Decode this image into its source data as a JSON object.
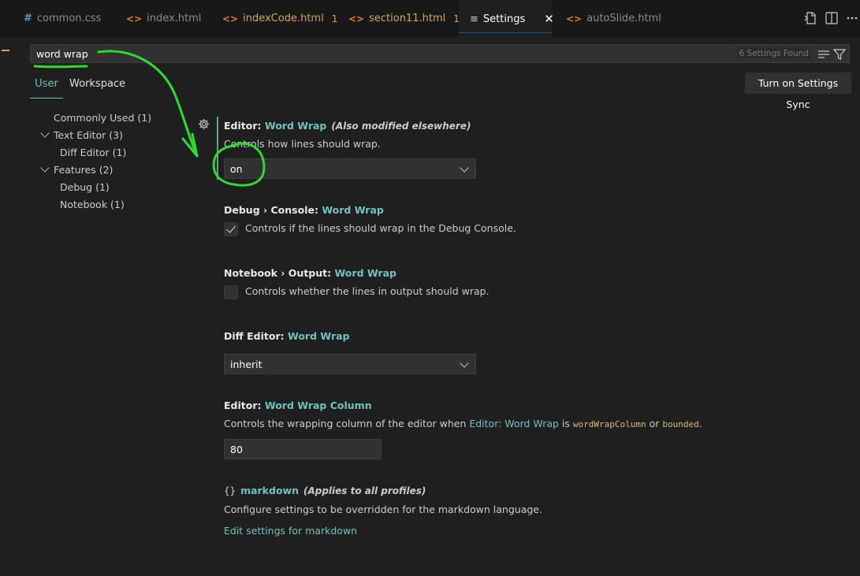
{
  "tabs": [
    {
      "label": "common.css",
      "icon": "hash-icon",
      "modified": false,
      "active": false
    },
    {
      "label": "index.html",
      "icon": "code-icon",
      "modified": false,
      "active": false
    },
    {
      "label": "indexCode.html",
      "icon": "code-icon",
      "modified": true,
      "badge": "1",
      "active": false
    },
    {
      "label": "section11.html",
      "icon": "code-icon",
      "modified": true,
      "badge": "1",
      "active": false
    },
    {
      "label": "Settings",
      "icon": "settings-lines-icon",
      "modified": false,
      "active": true,
      "close": "✕"
    },
    {
      "label": "autoSlide.html",
      "icon": "code-icon",
      "modified": false,
      "active": false
    }
  ],
  "toolbar_icons": [
    "open-settings-json-icon",
    "split-editor-icon",
    "more-actions-icon"
  ],
  "search": {
    "value": "word wrap",
    "count": "6 Settings Found",
    "icons": [
      "clear-filter-icon",
      "filter-icon"
    ]
  },
  "scope_tabs": {
    "user": "User",
    "workspace": "Workspace"
  },
  "sync_button": "Turn on Settings Sync",
  "toc": [
    {
      "label": "Commonly Used (1)"
    },
    {
      "label": "Text Editor (3)",
      "expanded": true
    },
    {
      "label": "Diff Editor (1)"
    },
    {
      "label": "Features (2)",
      "expanded": true
    },
    {
      "label": "Debug (1)"
    },
    {
      "label": "Notebook (1)"
    }
  ],
  "settings": {
    "editor_word_wrap": {
      "category": "Editor: ",
      "key": "Word Wrap",
      "note": "(Also modified elsewhere)",
      "description": "Controls how lines should wrap.",
      "value": "on"
    },
    "debug_console_word_wrap": {
      "category": "Debug › Console: ",
      "key": "Word Wrap",
      "description": "Controls if the lines should wrap in the Debug Console.",
      "checked": true
    },
    "notebook_output_word_wrap": {
      "category": "Notebook › Output: ",
      "key": "Word Wrap",
      "description": "Controls whether the lines in output should wrap.",
      "checked": false
    },
    "diff_editor_word_wrap": {
      "category": "Diff Editor: ",
      "key": "Word Wrap",
      "value": "inherit"
    },
    "editor_word_wrap_column": {
      "category": "Editor: ",
      "key": "Word Wrap Column",
      "desc_prefix": "Controls the wrapping column of the editor when ",
      "desc_link": "Editor: Word Wrap",
      "desc_is": " is ",
      "desc_code1": "wordWrapColumn",
      "desc_or": " or ",
      "desc_code2": "bounded",
      "desc_end": ".",
      "value": "80"
    },
    "markdown": {
      "braces": "{}",
      "key": "markdown",
      "note": "(Applies to all profiles)",
      "description": "Configure settings to be overridden for the markdown language.",
      "link": "Edit settings for markdown"
    }
  },
  "colors": {
    "accent": "#6fc3bd",
    "modified_tab": "#d7a35a",
    "annotation": "#2ddc2d"
  }
}
